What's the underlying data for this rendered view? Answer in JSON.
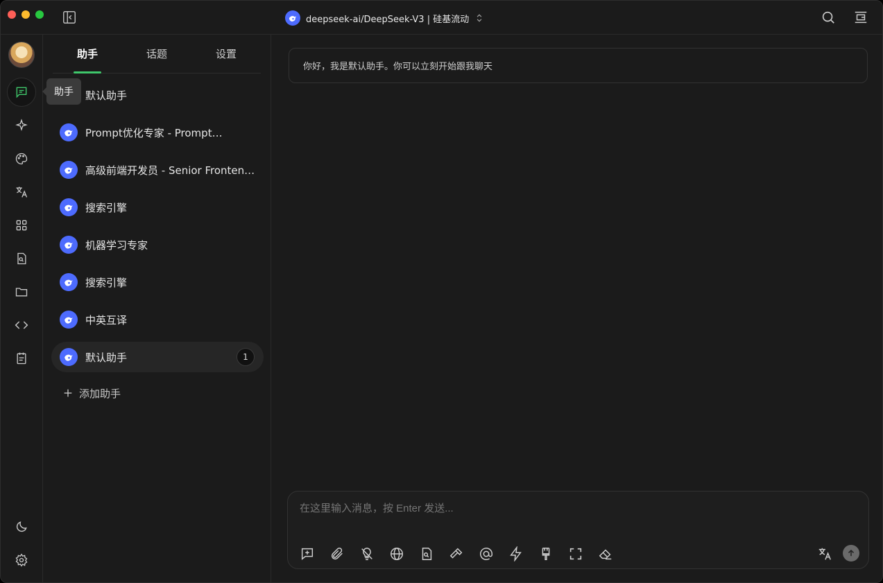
{
  "window": {
    "model_label": "deepseek-ai/DeepSeek-V3 | 硅基流动"
  },
  "rail": {
    "tooltip": "助手",
    "items": [
      {
        "name": "chat-icon"
      },
      {
        "name": "sparkle-icon"
      },
      {
        "name": "palette-icon"
      },
      {
        "name": "translate-icon"
      },
      {
        "name": "apps-icon"
      },
      {
        "name": "file-search-icon"
      },
      {
        "name": "folder-icon"
      },
      {
        "name": "code-icon"
      },
      {
        "name": "notes-icon"
      },
      {
        "name": "moon-icon"
      },
      {
        "name": "gear-icon"
      }
    ]
  },
  "panel": {
    "tabs": [
      "助手",
      "话题",
      "设置"
    ],
    "assistants": [
      {
        "name": "默认助手"
      },
      {
        "name": "Prompt优化专家 - Prompt Optimization Expert"
      },
      {
        "name": "高级前端开发员 - Senior Frontend Developer"
      },
      {
        "name": "搜索引擎"
      },
      {
        "name": "机器学习专家"
      },
      {
        "name": "搜索引擎"
      },
      {
        "name": "中英互译"
      },
      {
        "name": "默认助手",
        "badge": "1"
      }
    ],
    "add_label": "添加助手"
  },
  "chat": {
    "welcome": "你好，我是默认助手。你可以立刻开始跟我聊天",
    "input_placeholder": "在这里输入消息，按 Enter 发送..."
  },
  "colors": {
    "accent": "#3fc76b",
    "deepseek_blue": "#4d6bfe",
    "background": "#1b1b1b"
  }
}
